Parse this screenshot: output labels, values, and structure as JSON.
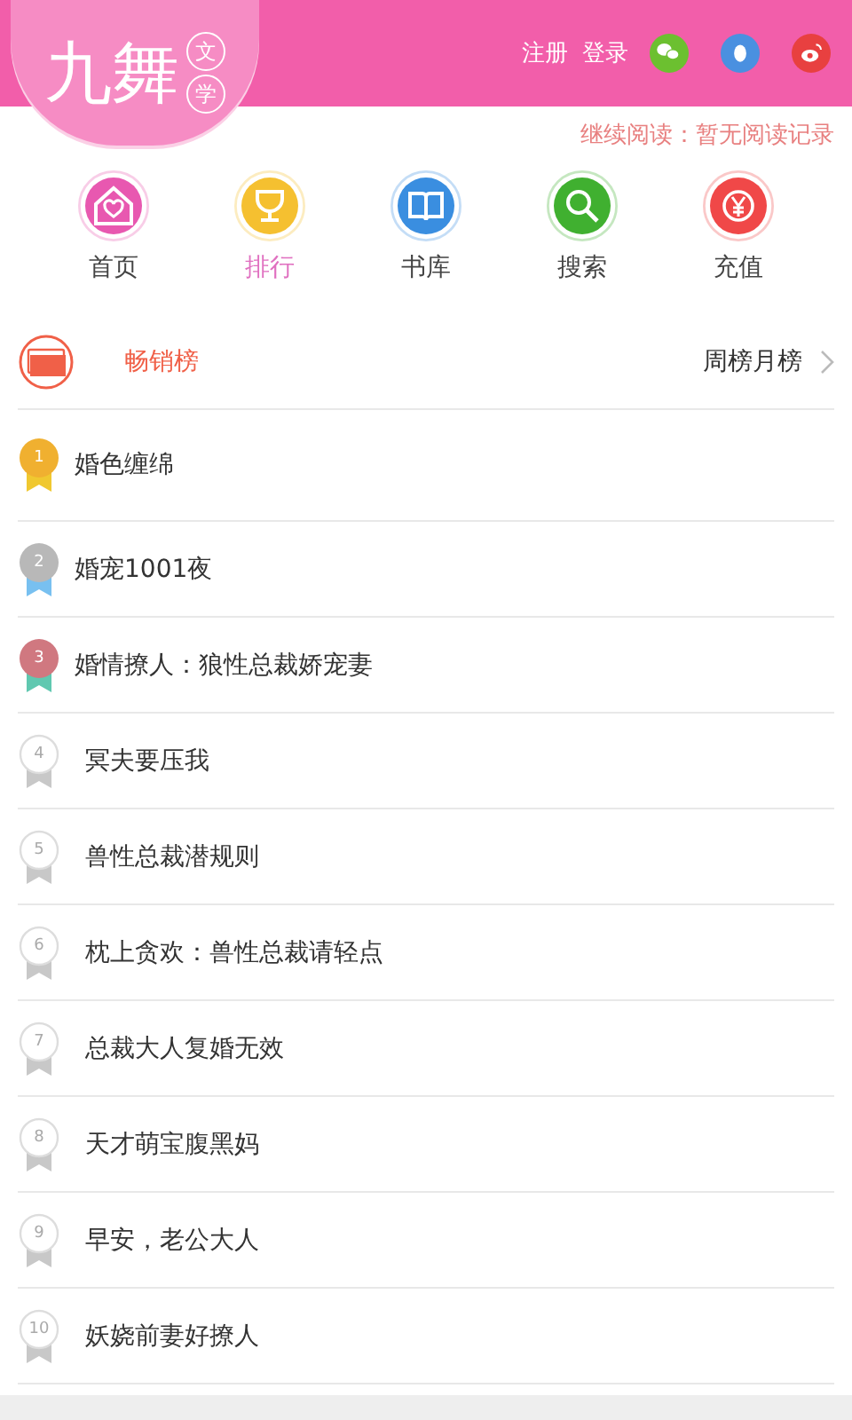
{
  "header": {
    "logo": "九舞",
    "logo_badge": [
      "文",
      "学"
    ],
    "links": [
      "注册",
      "登录"
    ]
  },
  "continue_reading": "继续阅读：暂无阅读记录",
  "nav": [
    {
      "label": "首页",
      "selected": false,
      "color": "#e858b0"
    },
    {
      "label": "排行",
      "selected": true,
      "color": "#f5c030"
    },
    {
      "label": "书库",
      "selected": false,
      "color": "#3a8ee0"
    },
    {
      "label": "搜索",
      "selected": false,
      "color": "#40b030"
    },
    {
      "label": "充值",
      "selected": false,
      "color": "#f04848"
    }
  ],
  "section": {
    "title": "畅销榜",
    "link": "周榜月榜"
  },
  "ranking": [
    {
      "rank": "1",
      "title": "婚色缠绵",
      "kind": "top",
      "color": "#f0b030"
    },
    {
      "rank": "2",
      "title": "婚宠1001夜",
      "kind": "top",
      "color": "#b8b8b8"
    },
    {
      "rank": "3",
      "title": "婚情撩人：狼性总裁娇宠妻",
      "kind": "top",
      "color": "#d07880"
    },
    {
      "rank": "4",
      "title": "冥夫要压我",
      "kind": "plain"
    },
    {
      "rank": "5",
      "title": "兽性总裁潜规则",
      "kind": "plain"
    },
    {
      "rank": "6",
      "title": "枕上贪欢：兽性总裁请轻点",
      "kind": "plain"
    },
    {
      "rank": "7",
      "title": "总裁大人复婚无效",
      "kind": "plain"
    },
    {
      "rank": "8",
      "title": "天才萌宝腹黑妈",
      "kind": "plain"
    },
    {
      "rank": "9",
      "title": "早安，老公大人",
      "kind": "plain"
    },
    {
      "rank": "10",
      "title": "妖娆前妻好撩人",
      "kind": "plain"
    }
  ]
}
